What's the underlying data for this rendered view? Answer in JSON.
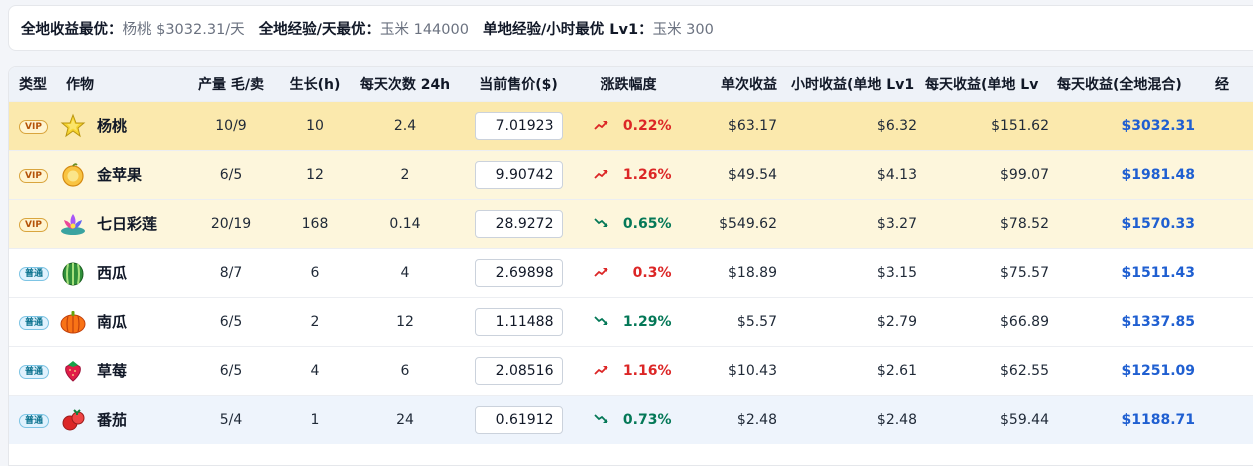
{
  "summary": {
    "best_income_label": "全地收益最优：",
    "best_income_value": "杨桃 $3032.31/天",
    "best_exp_day_label": "全地经验/天最优：",
    "best_exp_day_value": "玉米 144000",
    "best_exp_hour_label": "单地经验/小时最优 Lv1：",
    "best_exp_hour_value": "玉米 300"
  },
  "columns": {
    "type": "类型",
    "crop": "作物",
    "yield": "产量 毛/卖",
    "growth": "生长(h)",
    "times": "每天次数 24h",
    "price": "当前售价($)",
    "change": "涨跌幅度",
    "single": "单次收益",
    "hourly": "小时收益(单地 Lv1",
    "daily_single": "每天收益(单地 Lv",
    "daily_all": "每天收益(全地混合)",
    "extra": "经"
  },
  "colors": {
    "up": "#dc2626",
    "down": "#047857",
    "total": "#1f5fd1",
    "vip_row": "#fdf6dc"
  },
  "rows": [
    {
      "type": "VIP",
      "type_class": "vip",
      "icon": "star-fruit-icon",
      "name": "杨桃",
      "yield": "10/9",
      "growth": "10",
      "times": "2.4",
      "price": "7.01923",
      "trend": "up",
      "change": "0.22%",
      "single": "$63.17",
      "hourly": "$6.32",
      "daily_single": "$151.62",
      "daily_all": "$3032.31"
    },
    {
      "type": "VIP",
      "type_class": "vip",
      "icon": "golden-apple-icon",
      "name": "金苹果",
      "yield": "6/5",
      "growth": "12",
      "times": "2",
      "price": "9.90742",
      "trend": "up",
      "change": "1.26%",
      "single": "$49.54",
      "hourly": "$4.13",
      "daily_single": "$99.07",
      "daily_all": "$1981.48"
    },
    {
      "type": "VIP",
      "type_class": "vip",
      "icon": "lotus-icon",
      "name": "七日彩莲",
      "yield": "20/19",
      "growth": "168",
      "times": "0.14",
      "price": "28.9272",
      "trend": "down",
      "change": "0.65%",
      "single": "$549.62",
      "hourly": "$3.27",
      "daily_single": "$78.52",
      "daily_all": "$1570.33"
    },
    {
      "type": "普通",
      "type_class": "normal",
      "icon": "watermelon-icon",
      "name": "西瓜",
      "yield": "8/7",
      "growth": "6",
      "times": "4",
      "price": "2.69898",
      "trend": "up",
      "change": "0.3%",
      "single": "$18.89",
      "hourly": "$3.15",
      "daily_single": "$75.57",
      "daily_all": "$1511.43"
    },
    {
      "type": "普通",
      "type_class": "normal",
      "icon": "pumpkin-icon",
      "name": "南瓜",
      "yield": "6/5",
      "growth": "2",
      "times": "12",
      "price": "1.11488",
      "trend": "down",
      "change": "1.29%",
      "single": "$5.57",
      "hourly": "$2.79",
      "daily_single": "$66.89",
      "daily_all": "$1337.85"
    },
    {
      "type": "普通",
      "type_class": "normal",
      "icon": "strawberry-icon",
      "name": "草莓",
      "yield": "6/5",
      "growth": "4",
      "times": "6",
      "price": "2.08516",
      "trend": "up",
      "change": "1.16%",
      "single": "$10.43",
      "hourly": "$2.61",
      "daily_single": "$62.55",
      "daily_all": "$1251.09"
    },
    {
      "type": "普通",
      "type_class": "normal",
      "icon": "tomato-icon",
      "name": "番茄",
      "yield": "5/4",
      "growth": "1",
      "times": "24",
      "price": "0.61912",
      "trend": "down",
      "change": "0.73%",
      "single": "$2.48",
      "hourly": "$2.48",
      "daily_single": "$59.44",
      "daily_all": "$1188.71"
    }
  ]
}
